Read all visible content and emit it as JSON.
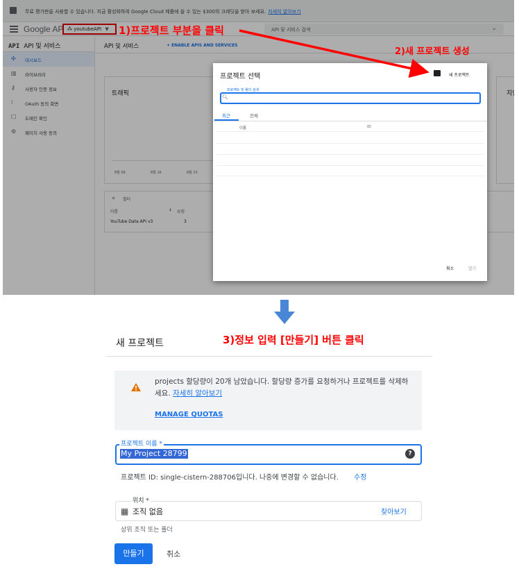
{
  "banner": {
    "text": "무료 평가판을 사용할 수 있습니다. 지금 활성화하여 Google Cloud 제품에 쓸 수 있는 $300의 크레딧을 받아 보세요.",
    "link": "자세히 알아보기"
  },
  "appbar": {
    "logo": "Google APIs",
    "project": "youtubeAPI",
    "search_placeholder": "API 및 서비스 검색"
  },
  "sidebar": {
    "header_icon": "API",
    "header": "API 및 서비스",
    "items": [
      {
        "label": "대시보드",
        "icon": "dashboard-icon",
        "glyph": "✣"
      },
      {
        "label": "라이브러리",
        "icon": "library-icon",
        "glyph": "▥"
      },
      {
        "label": "사용자 인증 정보",
        "icon": "key-icon",
        "glyph": "⚷"
      },
      {
        "label": "OAuth 동의 화면",
        "icon": "consent-icon",
        "glyph": "⁞"
      },
      {
        "label": "도메인 확인",
        "icon": "domain-icon",
        "glyph": "☐"
      },
      {
        "label": "페이지 사용 동의",
        "icon": "settings-icon",
        "glyph": "⚙"
      }
    ]
  },
  "main": {
    "title": "API 및 서비스",
    "enable_apis": "ENABLE APIS AND SERVICES",
    "traffic_title": "트래픽",
    "right_title": "지연",
    "x_ticks": [
      "8월 09",
      "8월 16",
      "8월 23"
    ],
    "filter_label": "필터",
    "table_headers": [
      "이름",
      "요청"
    ],
    "table_rows": [
      {
        "name": "YouTube Data API v3",
        "requests": "3"
      }
    ]
  },
  "dialog": {
    "title": "프로젝트 선택",
    "new_project": "새 프로젝트",
    "search_label": "프로젝트 및 폴더 검색",
    "tabs": [
      "최근",
      "전체"
    ],
    "columns": [
      "이름",
      "ID"
    ],
    "cancel": "취소",
    "open": "열기"
  },
  "annotations": {
    "step1": "1)프로젝트 부분을 클릭",
    "step2": "2)새 프로젝트 생성",
    "step3": "3)정보 입력  [만들기] 버튼 클릭"
  },
  "new_project": {
    "title": "새 프로젝트",
    "quota_text": "projects 할당량이 20개 남았습니다. 할당량 증가를 요청하거나 프로젝트를 삭제하세요.",
    "quota_link": "자세히 알아보기",
    "manage_quotas": "MANAGE QUOTAS",
    "name_label": "프로젝트 이름 *",
    "name_value": "My Project 28799",
    "project_id_text": "프로젝트 ID: single-cistern-288706입니다. 나중에 변경할 수 없습니다.",
    "edit": "수정",
    "location_label": "위치 *",
    "location_value": "조직 없음",
    "browse": "찾아보기",
    "location_hint": "상위 조직 또는 폴더",
    "create": "만들기",
    "cancel": "취소"
  },
  "colors": {
    "accent": "#1a73e8",
    "annotation": "#ff0000",
    "warning": "#e37400"
  }
}
